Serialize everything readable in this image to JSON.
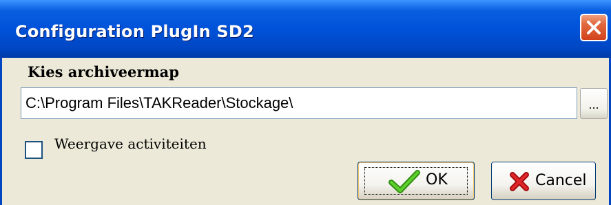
{
  "window": {
    "title": "Configuration PlugIn SD2",
    "close_icon": "close-icon"
  },
  "form": {
    "folder_label": "Kies archiveermap",
    "folder_path": "C:\\Program Files\\TAKReader\\Stockage\\",
    "browse_label": "...",
    "show_activities_label": "Weergave activiteiten",
    "show_activities_checked": false
  },
  "buttons": {
    "ok_label": "OK",
    "ok_icon": "checkmark-icon",
    "cancel_label": "Cancel",
    "cancel_icon": "red-x-icon"
  },
  "colors": {
    "titlebar": "#0052d9",
    "dialog_background": "#ece9d8",
    "close_button": "#d2421c",
    "ok_check": "#3aa815",
    "cancel_x": "#c8171a"
  }
}
